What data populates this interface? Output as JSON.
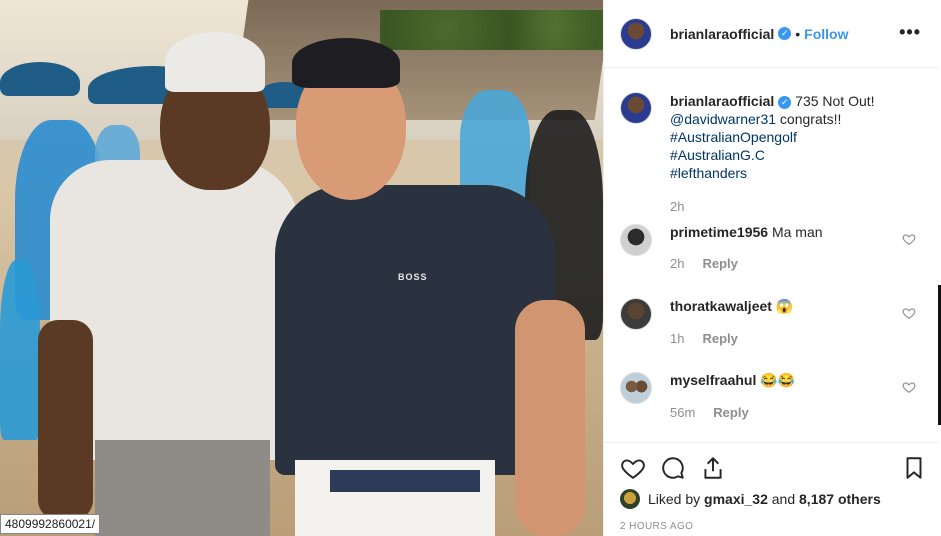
{
  "photo": {
    "brand_text": "BOSS",
    "watermark": "4809992860021/"
  },
  "header": {
    "username": "brianlaraofficial",
    "separator": "•",
    "follow_label": "Follow",
    "more_label": "•••"
  },
  "caption": {
    "username": "brianlaraofficial",
    "text": "735 Not Out!",
    "mention": "@davidwarner31",
    "after_mention": " congrats!!",
    "tags": [
      "#AustralianOpengolf",
      "#AustralianG.C",
      "#lefthanders"
    ],
    "time": "2h"
  },
  "comments": [
    {
      "username": "primetime1956",
      "text": "Ma man",
      "time": "2h",
      "reply": "Reply"
    },
    {
      "username": "thoratkawaljeet",
      "text": "😱",
      "time": "1h",
      "reply": "Reply"
    },
    {
      "username": "myselfraahul",
      "text": "😂😂",
      "time": "56m",
      "reply": "Reply"
    }
  ],
  "actions": {
    "liked_by_prefix": "Liked by ",
    "liked_by_user": "gmaxi_32",
    "liked_by_mid": " and ",
    "liked_by_count": "8,187 others",
    "posted": "2 HOURS AGO"
  },
  "colors": {
    "link": "#003569",
    "accent": "#3897f0",
    "muted": "#8e8e8e"
  }
}
